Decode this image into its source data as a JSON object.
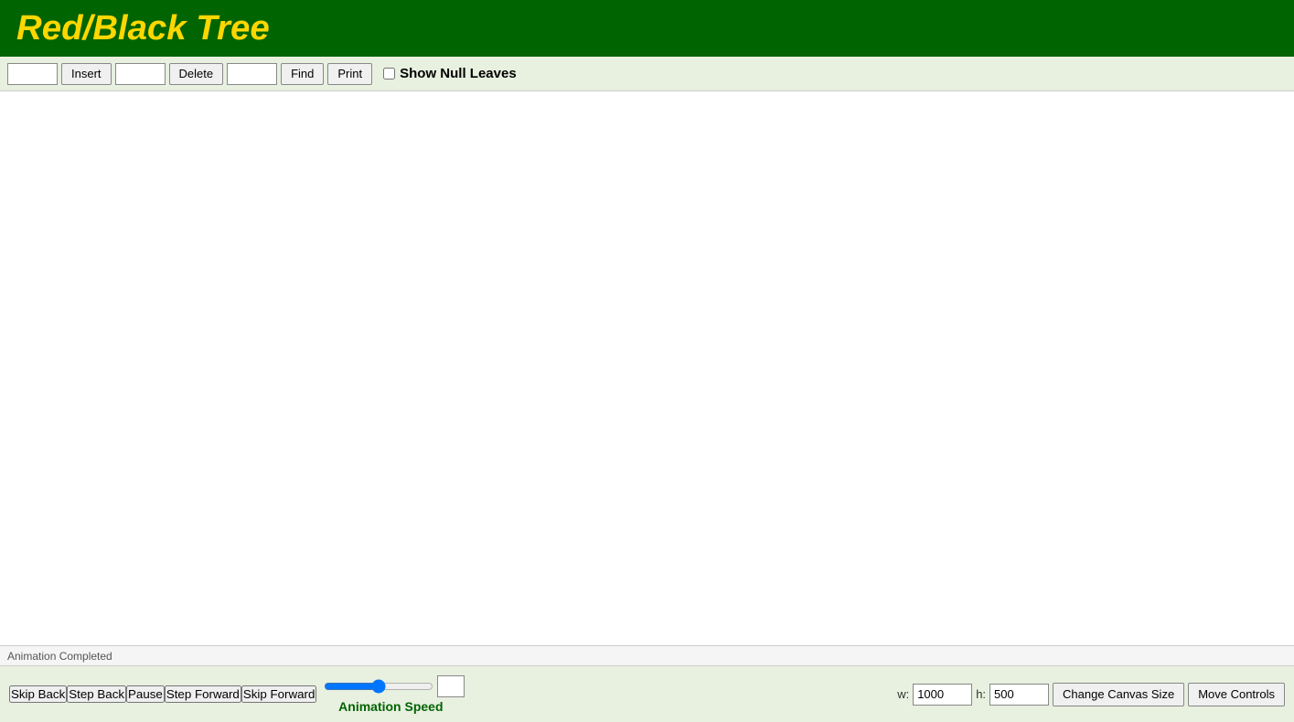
{
  "header": {
    "title": "Red/Black Tree"
  },
  "toolbar": {
    "insert_value": "",
    "insert_button": "Insert",
    "delete_value": "",
    "delete_button": "Delete",
    "find_value": "",
    "find_button": "Find",
    "print_button": "Print",
    "show_null_leaves_label": "Show Null Leaves",
    "show_null_leaves_checked": false
  },
  "status": {
    "text": "Animation Completed"
  },
  "bottom": {
    "skip_back": "Skip Back",
    "step_back": "Step Back",
    "pause": "Pause",
    "step_forward": "Step Forward",
    "skip_forward": "Skip Forward",
    "animation_speed_label": "Animation Speed",
    "canvas_width_label": "w:",
    "canvas_width_value": "1000",
    "canvas_height_label": "h:",
    "canvas_height_value": "500",
    "change_canvas_size": "Change Canvas Size",
    "move_controls": "Move Controls"
  }
}
